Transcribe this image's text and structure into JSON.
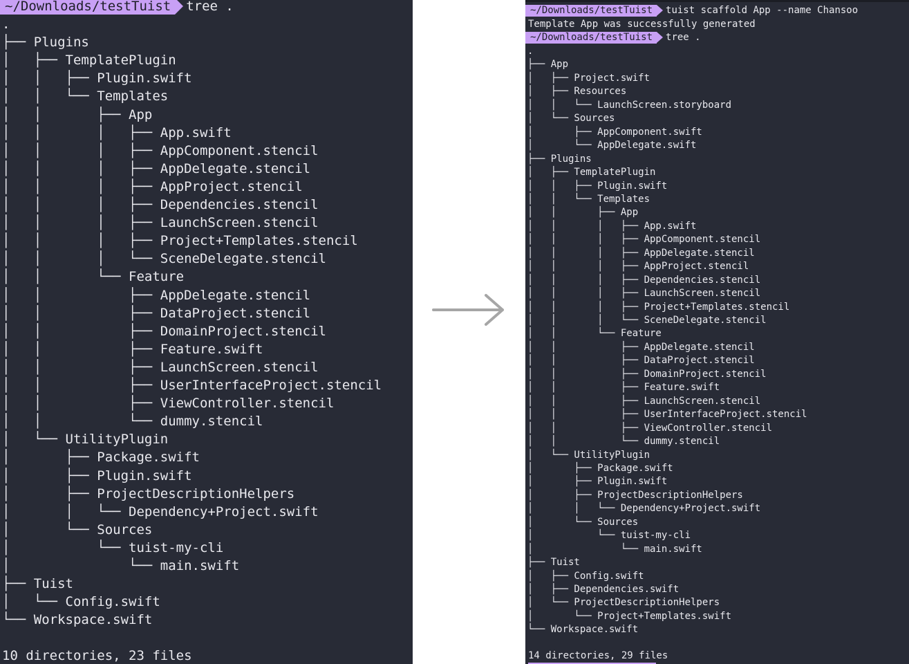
{
  "left_terminal": {
    "prompt_path": "~/Downloads/testTuist",
    "command": "tree .",
    "tree_lines": [
      ".",
      "├── Plugins",
      "│   ├── TemplatePlugin",
      "│   │   ├── Plugin.swift",
      "│   │   └── Templates",
      "│   │       ├── App",
      "│   │       │   ├── App.swift",
      "│   │       │   ├── AppComponent.stencil",
      "│   │       │   ├── AppDelegate.stencil",
      "│   │       │   ├── AppProject.stencil",
      "│   │       │   ├── Dependencies.stencil",
      "│   │       │   ├── LaunchScreen.stencil",
      "│   │       │   ├── Project+Templates.stencil",
      "│   │       │   └── SceneDelegate.stencil",
      "│   │       └── Feature",
      "│   │           ├── AppDelegate.stencil",
      "│   │           ├── DataProject.stencil",
      "│   │           ├── DomainProject.stencil",
      "│   │           ├── Feature.swift",
      "│   │           ├── LaunchScreen.stencil",
      "│   │           ├── UserInterfaceProject.stencil",
      "│   │           ├── ViewController.stencil",
      "│   │           └── dummy.stencil",
      "│   └── UtilityPlugin",
      "│       ├── Package.swift",
      "│       ├── Plugin.swift",
      "│       ├── ProjectDescriptionHelpers",
      "│       │   └── Dependency+Project.swift",
      "│       └── Sources",
      "│           └── tuist-my-cli",
      "│               └── main.swift",
      "├── Tuist",
      "│   └── Config.swift",
      "└── Workspace.swift"
    ],
    "summary": "10 directories, 23 files"
  },
  "right_terminal": {
    "prompt1_path": "~/Downloads/testTuist",
    "command1": "tuist scaffold App --name Chansoo",
    "output1": "Template App was successfully generated",
    "prompt2_path": "~/Downloads/testTuist",
    "command2": "tree .",
    "tree_lines": [
      ".",
      "├── App",
      "│   ├── Project.swift",
      "│   ├── Resources",
      "│   │   └── LaunchScreen.storyboard",
      "│   └── Sources",
      "│       ├── AppComponent.swift",
      "│       └── AppDelegate.swift",
      "├── Plugins",
      "│   ├── TemplatePlugin",
      "│   │   ├── Plugin.swift",
      "│   │   └── Templates",
      "│   │       ├── App",
      "│   │       │   ├── App.swift",
      "│   │       │   ├── AppComponent.stencil",
      "│   │       │   ├── AppDelegate.stencil",
      "│   │       │   ├── AppProject.stencil",
      "│   │       │   ├── Dependencies.stencil",
      "│   │       │   ├── LaunchScreen.stencil",
      "│   │       │   ├── Project+Templates.stencil",
      "│   │       │   └── SceneDelegate.stencil",
      "│   │       └── Feature",
      "│   │           ├── AppDelegate.stencil",
      "│   │           ├── DataProject.stencil",
      "│   │           ├── DomainProject.stencil",
      "│   │           ├── Feature.swift",
      "│   │           ├── LaunchScreen.stencil",
      "│   │           ├── UserInterfaceProject.stencil",
      "│   │           ├── ViewController.stencil",
      "│   │           └── dummy.stencil",
      "│   └── UtilityPlugin",
      "│       ├── Package.swift",
      "│       ├── Plugin.swift",
      "│       ├── ProjectDescriptionHelpers",
      "│       │   └── Dependency+Project.swift",
      "│       └── Sources",
      "│           └── tuist-my-cli",
      "│               └── main.swift",
      "├── Tuist",
      "│   ├── Config.swift",
      "│   ├── Dependencies.swift",
      "│   └── ProjectDescriptionHelpers",
      "│       └── Project+Templates.swift",
      "└── Workspace.swift"
    ],
    "summary": "14 directories, 29 files"
  },
  "colors": {
    "terminal_bg": "#282b36",
    "text": "#e9e9ee",
    "prompt_bg": "#c8a0f5",
    "arrow": "#a6a6a6"
  },
  "arrow_icon": "right-arrow-icon"
}
